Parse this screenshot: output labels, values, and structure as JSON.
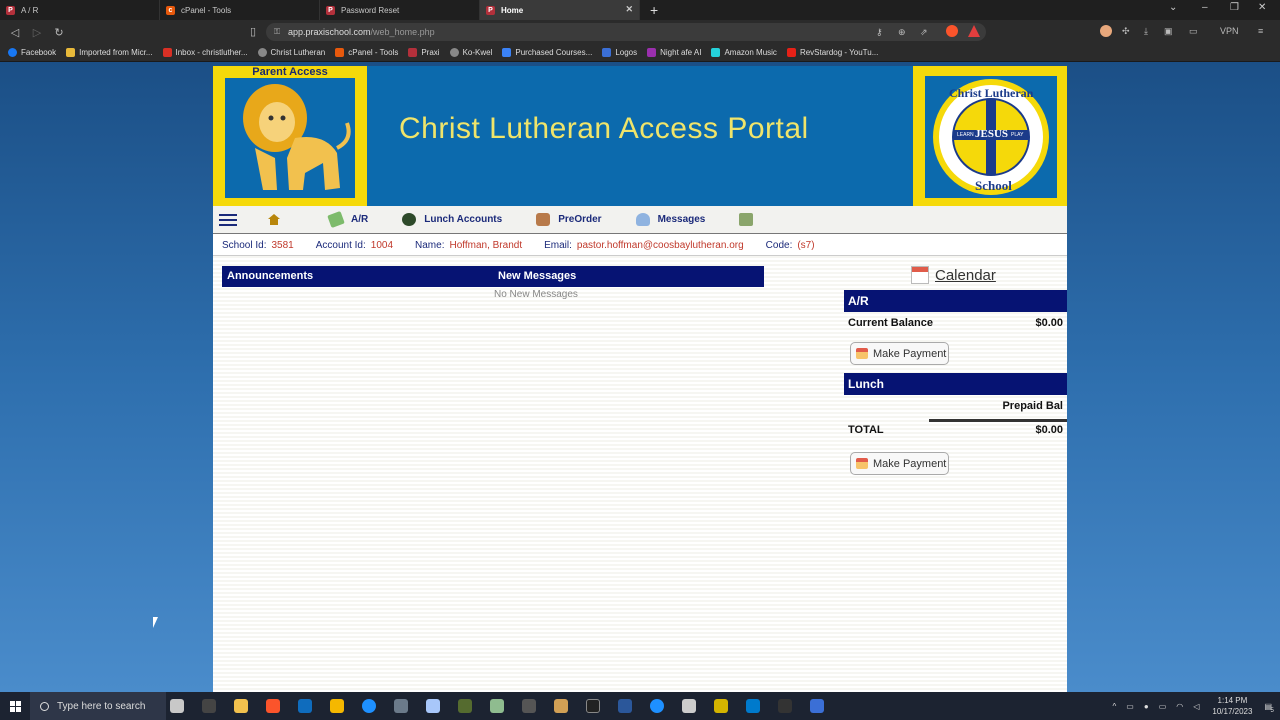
{
  "browser": {
    "tabs": [
      {
        "label": "A / R",
        "color": "#b3303b",
        "active": false
      },
      {
        "label": "cPanel - Tools",
        "color": "#e8590c",
        "active": false
      },
      {
        "label": "Password Reset",
        "color": "#b3303b",
        "active": false
      },
      {
        "label": "Home",
        "color": "#b3303b",
        "active": true
      }
    ],
    "url_host": "app.praxischool.com",
    "url_path": "/web_home.php",
    "vpn_label": "VPN",
    "bookmarks": [
      {
        "label": "Facebook",
        "color": "#1877f2"
      },
      {
        "label": "Imported from Micr...",
        "color": "#e8b93a"
      },
      {
        "label": "Inbox - christluther...",
        "color": "#d93025"
      },
      {
        "label": "Christ Lutheran",
        "color": "#888888"
      },
      {
        "label": "cPanel - Tools",
        "color": "#e8590c"
      },
      {
        "label": "Praxi",
        "color": "#b3303b"
      },
      {
        "label": "Ko-Kwel",
        "color": "#888888"
      },
      {
        "label": "Purchased Courses...",
        "color": "#3b82f6"
      },
      {
        "label": "Logos",
        "color": "#3b6fd6"
      },
      {
        "label": "Night afe AI",
        "color": "#9b2fae"
      },
      {
        "label": "Amazon Music",
        "color": "#25d1da"
      },
      {
        "label": "RevStardog - YouTu...",
        "color": "#e62117"
      }
    ]
  },
  "portal": {
    "parent_access": "Parent Access",
    "title": "Christ Lutheran Access Portal",
    "seal_top": "Christ Lutheran",
    "seal_bottom": "School",
    "seal_center": "JESUS",
    "seal_left": "LEARN",
    "seal_right": "PLAY",
    "nav": [
      {
        "label": "A/R",
        "icon": "money-icon"
      },
      {
        "label": "Lunch Accounts",
        "icon": "lunch-icon"
      },
      {
        "label": "PreOrder",
        "icon": "preorder-icon"
      },
      {
        "label": "Messages",
        "icon": "person-icon"
      }
    ],
    "info": {
      "school_id_label": "School Id:",
      "school_id": "3581",
      "account_id_label": "Account Id:",
      "account_id": "1004",
      "name_label": "Name:",
      "name": "Hoffman, Brandt",
      "email_label": "Email:",
      "email": "pastor.hoffman@coosbaylutheran.org",
      "code_label": "Code:",
      "code": "(s7)"
    },
    "announcements_label": "Announcements",
    "new_messages_label": "New Messages",
    "no_messages": "No New Messages",
    "calendar_label": "Calendar",
    "ar": {
      "header": "A/R",
      "current_balance_label": "Current Balance",
      "current_balance": "$0.00",
      "pay_label": "Make Payment"
    },
    "lunch": {
      "header": "Lunch",
      "prepaid_label": "Prepaid Bal",
      "total_label": "TOTAL",
      "total": "$0.00",
      "pay_label": "Make Payment"
    }
  },
  "taskbar": {
    "search_placeholder": "Type here to search",
    "time": "1:14 PM",
    "date": "10/17/2023",
    "notifications": "5"
  },
  "colors": {
    "navy": "#061373",
    "banner_blue": "#0c6aad",
    "banner_yellow": "#f5d90a",
    "value_red": "#c0392b"
  }
}
